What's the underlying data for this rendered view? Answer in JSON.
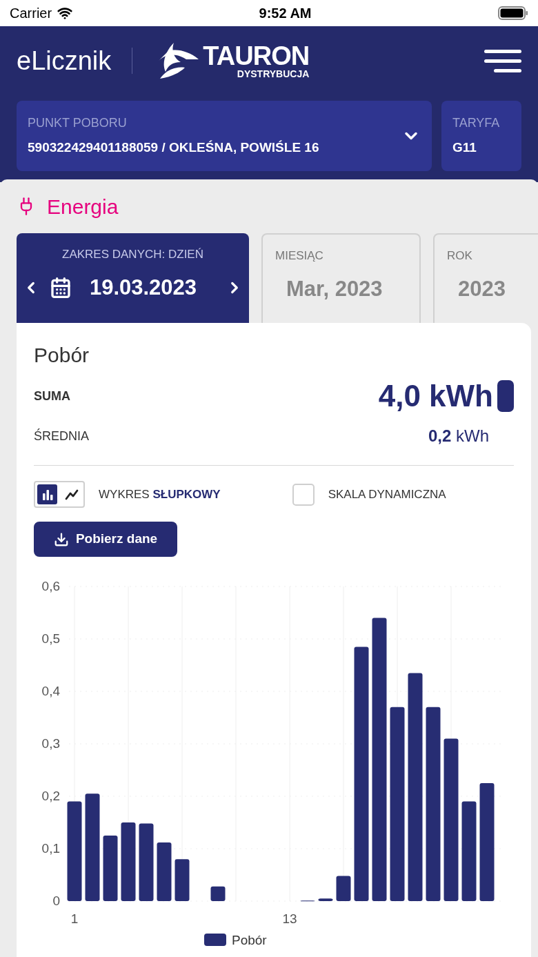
{
  "status_bar": {
    "carrier": "Carrier",
    "time": "9:52 AM"
  },
  "header": {
    "app_name": "eLicznik",
    "brand": "TAURON",
    "brand_sub": "DYSTRYBUCJA"
  },
  "selectors": [
    {
      "label": "PUNKT POBORU",
      "value": "590322429401188059 / OKLEŚNA, POWIŚLE 16",
      "kind": "dropdown"
    },
    {
      "label": "TARYFA",
      "value": "G11",
      "kind": "info"
    }
  ],
  "section_title": "Energia",
  "range_tabs": [
    {
      "label": "ZAKRES DANYCH: DZIEŃ",
      "value": "19.03.2023",
      "selected": true
    },
    {
      "label": "MIESIĄC",
      "value": "Mar, 2023",
      "selected": false
    },
    {
      "label": "ROK",
      "value": "2023",
      "selected": false
    }
  ],
  "card": {
    "title": "Pobór",
    "stats": [
      {
        "label": "SUMA",
        "value": "4,0 kWh",
        "kind": "total"
      },
      {
        "label": "ŚREDNIA",
        "value": "**0,2** kWh",
        "kind": "average"
      }
    ],
    "chart_toggle": [
      {
        "kind": "bar",
        "selected": true
      },
      {
        "kind": "line",
        "selected": false
      }
    ],
    "chart_type_label": "WYKRES **SŁUPKOWY**",
    "dynamic_scale": {
      "label": "SKALA DYNAMICZNA",
      "checked": false
    },
    "download_button": "Pobierz dane",
    "chart_data": {
      "type": "bar",
      "x": [
        1,
        2,
        3,
        4,
        5,
        6,
        7,
        8,
        9,
        10,
        11,
        12,
        13,
        14,
        15,
        16,
        17,
        18,
        19,
        20,
        21,
        22,
        23,
        24
      ],
      "grid": true,
      "series": [
        {
          "name": "Pobór",
          "color": "#272d73",
          "values": [
            0.19,
            0.205,
            0.125,
            0.15,
            0.148,
            0.112,
            0.08,
            0,
            0.028,
            0,
            0,
            0,
            0,
            0.001,
            0.005,
            0.048,
            0.485,
            0.54,
            0.37,
            0.435,
            0.37,
            0.31,
            0.19,
            0.225
          ]
        }
      ],
      "xlim": [
        0.5,
        24.5
      ],
      "ylim": [
        0,
        0.6
      ],
      "yticks": [
        {
          "value": 0,
          "label": "0"
        },
        {
          "value": 0.1,
          "label": "0,1"
        },
        {
          "value": 0.2,
          "label": "0,2"
        },
        {
          "value": 0.3,
          "label": "0,3"
        },
        {
          "value": 0.4,
          "label": "0,4"
        },
        {
          "value": 0.5,
          "label": "0,5"
        },
        {
          "value": 0.6,
          "label": "0,6"
        }
      ],
      "xticks": [
        1,
        13
      ]
    }
  }
}
